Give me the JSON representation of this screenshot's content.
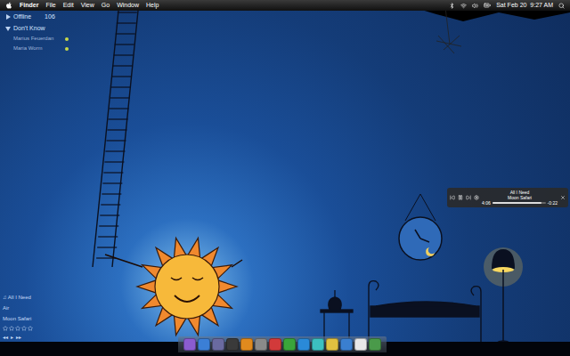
{
  "menu_bar": {
    "items": [
      {
        "label": "Finder",
        "bold": true
      },
      {
        "label": "File",
        "bold": false
      },
      {
        "label": "Edit",
        "bold": false
      },
      {
        "label": "View",
        "bold": false
      },
      {
        "label": "Go",
        "bold": false
      },
      {
        "label": "Window",
        "bold": false
      },
      {
        "label": "Help",
        "bold": false
      }
    ],
    "clock": "Sat Feb 20  9:27 AM"
  },
  "buddy_list": {
    "groups": [
      {
        "name": "Offline",
        "count": "106",
        "expanded": false,
        "contacts": []
      },
      {
        "name": "Don't Know",
        "count": "",
        "expanded": true,
        "contacts": [
          {
            "name": "Marius Feuerdan",
            "color": "#c8d84a"
          },
          {
            "name": "Maria Worm",
            "color": "#c8d84a"
          }
        ]
      }
    ]
  },
  "mini_player": {
    "title": "All I Need",
    "album": "Moon Safari",
    "elapsed": "4:06",
    "remaining": "-0:22",
    "level": 0.92
  },
  "now_playing": {
    "song": "♫ All I Need",
    "artist": "Air",
    "album": "Moon Safari",
    "stars": 0,
    "controls": [
      "◂◂",
      "▸",
      "▸▸"
    ]
  },
  "dock": {
    "items": [
      {
        "color": "#8a5cd0"
      },
      {
        "color": "#3b7fd6"
      },
      {
        "color": "#6a6aa0"
      },
      {
        "color": "#3a3a3a"
      },
      {
        "color": "#e08a1e"
      },
      {
        "color": "#8a8a8a"
      },
      {
        "color": "#d23a3a"
      },
      {
        "color": "#3aa53a"
      },
      {
        "color": "#2a8ad8"
      },
      {
        "color": "#3cc0c0"
      },
      {
        "color": "#e0c040"
      },
      {
        "color": "#3a7fd0"
      },
      {
        "color": "#e8e8e8"
      },
      {
        "color": "#4a9a4a"
      }
    ]
  }
}
